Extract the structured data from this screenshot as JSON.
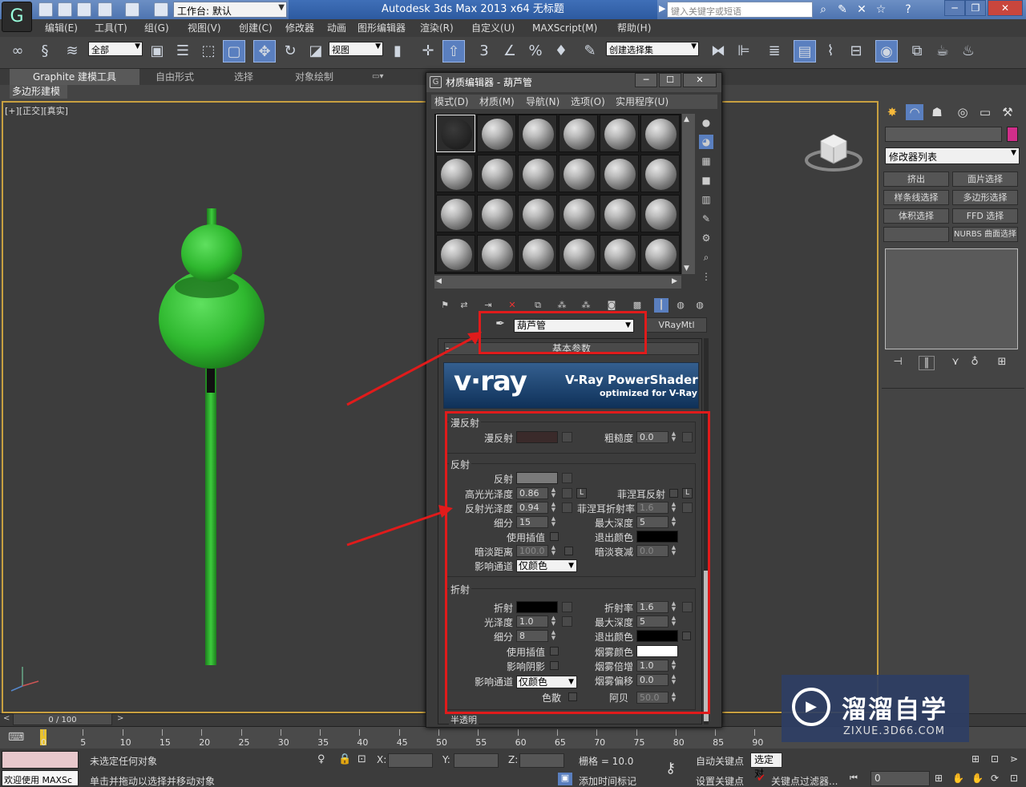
{
  "app": {
    "logo": "G",
    "workspace_label": "工作台: 默认",
    "title": "Autodesk 3ds Max  2013 x64     无标题",
    "search_placeholder": "键入关键字或短语"
  },
  "menu": [
    "编辑(E)",
    "工具(T)",
    "组(G)",
    "视图(V)",
    "创建(C)",
    "修改器",
    "动画",
    "图形编辑器",
    "渲染(R)",
    "自定义(U)",
    "MAXScript(M)",
    "帮助(H)"
  ],
  "toolbar": {
    "selection_filter": "全部",
    "ref_coord": "视图",
    "named_selection": "创建选择集"
  },
  "ribbon": {
    "tabs": [
      "Graphite 建模工具",
      "自由形式",
      "选择",
      "对象绘制"
    ],
    "subtab": "多边形建模"
  },
  "viewport": {
    "label": "[+][正交][真实]"
  },
  "command_panel": {
    "modifier_list": "修改器列表",
    "buttons": [
      "挤出",
      "面片选择",
      "样条线选择",
      "多边形选择",
      "体积选择",
      "FFD 选择",
      "",
      "NURBS 曲面选择"
    ]
  },
  "material_editor": {
    "title": "材质编辑器 - 葫芦管",
    "title_icon": "G",
    "menu": [
      "模式(D)",
      "材质(M)",
      "导航(N)",
      "选项(O)",
      "实用程序(U)"
    ],
    "material_name": "葫芦管",
    "material_type": "VRayMtl",
    "rollout_title": "基本参数",
    "vray_logo": "v·ray",
    "vray_title": "V-Ray PowerShader",
    "vray_subtitle": "optimized for V-Ray",
    "diffuse": {
      "group": "漫反射",
      "diffuse_label": "漫反射",
      "roughness_label": "粗糙度",
      "roughness": "0.0",
      "diffuse_color": "#3a2a2a"
    },
    "reflection": {
      "group": "反射",
      "reflect_label": "反射",
      "reflect_color": "#7a7a7a",
      "hilight_gloss_label": "高光光泽度",
      "hilight_gloss": "0.86",
      "refl_gloss_label": "反射光泽度",
      "refl_gloss": "0.94",
      "subdivs_label": "细分",
      "subdivs": "15",
      "use_interp_label": "使用插值",
      "dim_dist_label": "暗淡距离",
      "dim_dist": "100.0",
      "affect_channels_label": "影响通道",
      "affect_channels": "仅颜色",
      "fresnel_label": "菲涅耳反射",
      "fresnel_ior_label": "菲涅耳折射率",
      "fresnel_ior": "1.6",
      "max_depth_label": "最大深度",
      "max_depth": "5",
      "exit_color_label": "退出颜色",
      "exit_color": "#000000",
      "dim_falloff_label": "暗淡衰减",
      "dim_falloff": "0.0",
      "l_button": "L"
    },
    "refraction": {
      "group": "折射",
      "refract_label": "折射",
      "refract_color": "#000000",
      "gloss_label": "光泽度",
      "gloss": "1.0",
      "subdivs_label": "细分",
      "subdivs": "8",
      "use_interp_label": "使用插值",
      "affect_shadows_label": "影响阴影",
      "affect_channels_label": "影响通道",
      "affect_channels": "仅颜色",
      "dispersion_label": "色散",
      "ior_label": "折射率",
      "ior": "1.6",
      "max_depth_label": "最大深度",
      "max_depth": "5",
      "exit_color_label": "退出颜色",
      "exit_color": "#000000",
      "fog_color_label": "烟雾颜色",
      "fog_color": "#ffffff",
      "fog_mult_label": "烟雾倍增",
      "fog_mult": "1.0",
      "fog_bias_label": "烟雾偏移",
      "fog_bias": "0.0",
      "abbe_label": "阿贝",
      "abbe": "50.0"
    },
    "next_group": "半透明"
  },
  "timeline": {
    "frame": "0 / 100",
    "ticks": [
      "0",
      "5",
      "10",
      "15",
      "20",
      "25",
      "30",
      "35",
      "40",
      "45",
      "50",
      "55",
      "60",
      "65",
      "70",
      "75",
      "80",
      "85",
      "90"
    ]
  },
  "status": {
    "listener": "欢迎使用 MAXSc",
    "selection": "未选定任何对象",
    "prompt": "单击并拖动以选择并移动对象",
    "x_label": "X:",
    "y_label": "Y:",
    "z_label": "Z:",
    "grid": "栅格 = 10.0",
    "add_time_tag": "添加时间标记",
    "auto_key": "自动关键点",
    "set_key": "设置关键点",
    "selected": "选定对",
    "key_filter": "关键点过滤器...",
    "frame_field": "0"
  },
  "watermark": {
    "brand": "溜溜自学",
    "url": "ZIXUE.3D66.COM",
    "logo": "▶"
  },
  "colors": {
    "highlight_red": "#e01b1b",
    "gourd_green": "#2fb82f",
    "viewport_border": "#c8a040"
  }
}
